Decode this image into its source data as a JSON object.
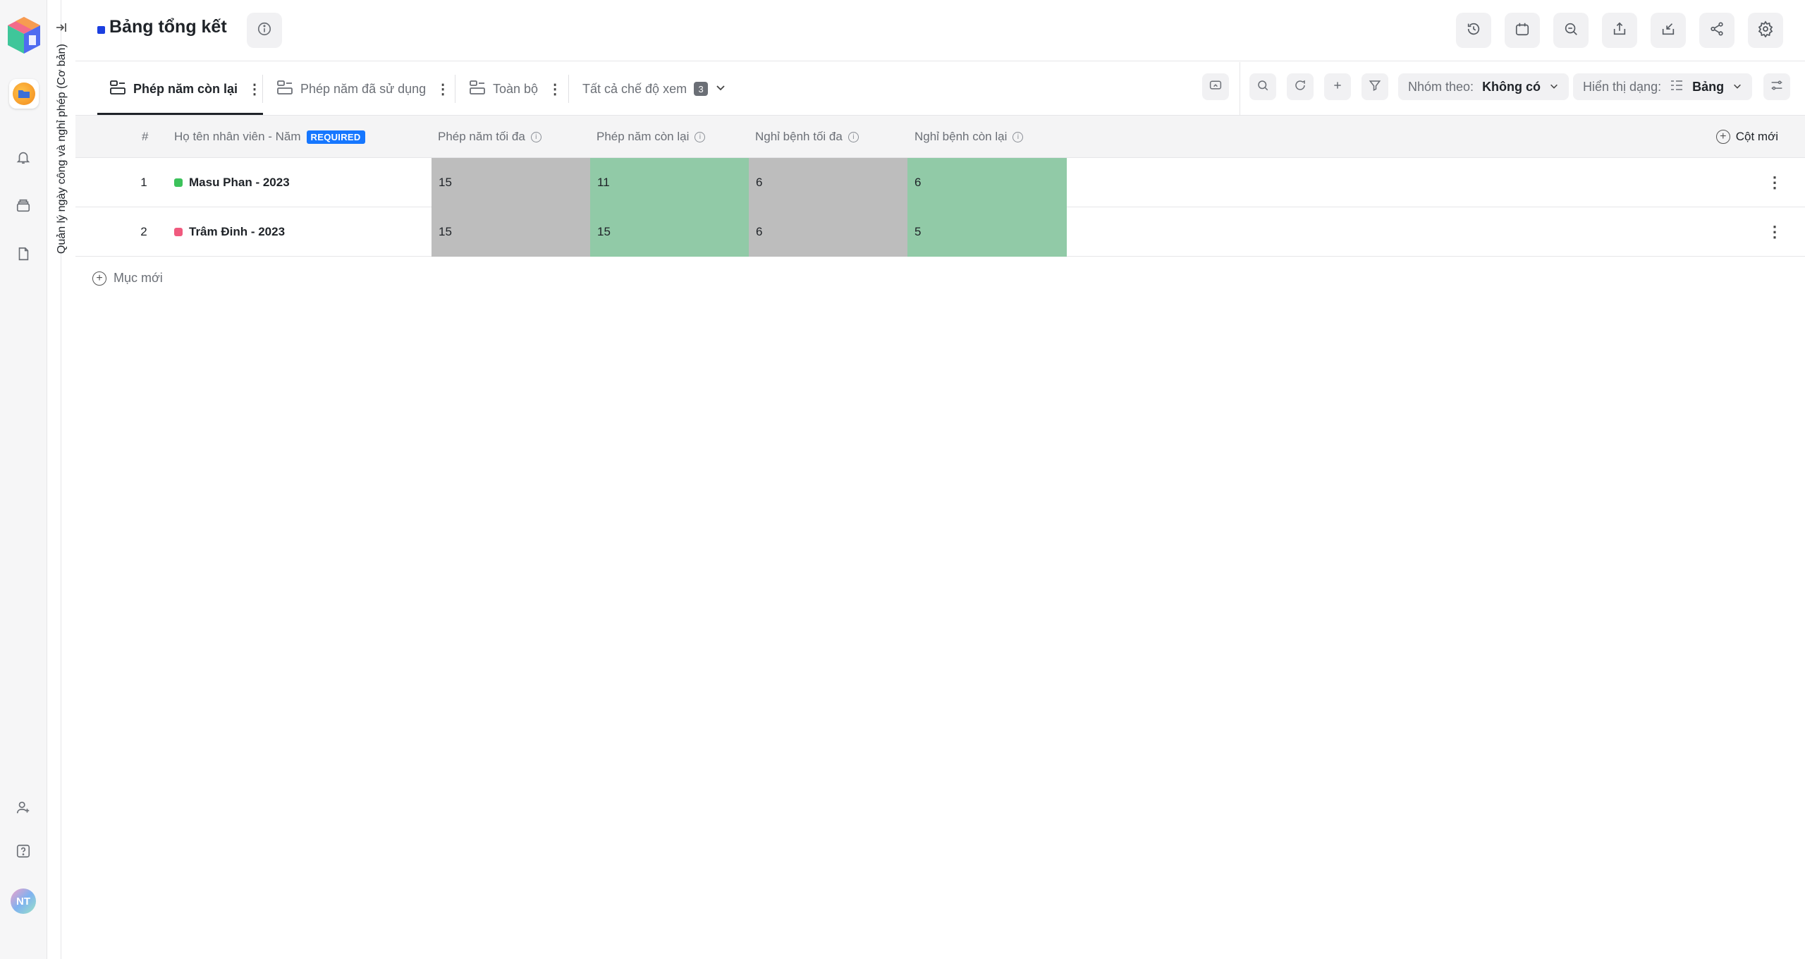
{
  "sidebar": {
    "workspace_icon": "folder-icon",
    "nav_icons": [
      "bell-icon",
      "layers-icon",
      "document-icon"
    ],
    "bottom_icons": [
      "add-user-icon",
      "help-icon"
    ],
    "user_initials": "NT"
  },
  "app_strip": {
    "title": "Quản lý ngày công và nghỉ phép (Cơ bản)"
  },
  "header": {
    "title": "Bảng tổng kết",
    "title_color": "#1b3fe0",
    "actions": [
      "history-icon",
      "calendar-icon",
      "search-zoom-icon",
      "share-out-icon",
      "import-icon",
      "share-icon",
      "settings-icon"
    ]
  },
  "views": {
    "tabs": [
      {
        "label": "Phép năm còn lại",
        "active": true
      },
      {
        "label": "Phép năm đã sử dụng",
        "active": false
      },
      {
        "label": "Toàn bộ",
        "active": false
      }
    ],
    "all_views_label": "Tất cả chế độ xem",
    "all_views_count": "3"
  },
  "toolbar": {
    "group_by_label": "Nhóm theo:",
    "group_by_value": "Không có",
    "display_label": "Hiển thị dạng:",
    "display_value": "Bảng"
  },
  "table": {
    "index_header": "#",
    "columns": [
      {
        "label": "Họ tên nhân viên - Năm",
        "badge": "REQUIRED"
      },
      {
        "label": "Phép năm tối đa"
      },
      {
        "label": "Phép năm còn lại"
      },
      {
        "label": "Nghỉ bệnh tối đa"
      },
      {
        "label": "Nghỉ bệnh còn lại"
      }
    ],
    "new_column_label": "Cột mới",
    "rows": [
      {
        "index": "1",
        "name": "Masu Phan - 2023",
        "dot_color": "#3cc25b",
        "annual_max": "15",
        "annual_left": "11",
        "sick_max": "6",
        "sick_left": "6"
      },
      {
        "index": "2",
        "name": "Trâm Đinh - 2023",
        "dot_color": "#f05a7e",
        "annual_max": "15",
        "annual_left": "15",
        "sick_max": "6",
        "sick_left": "5"
      }
    ],
    "new_item_label": "Mục mới"
  }
}
